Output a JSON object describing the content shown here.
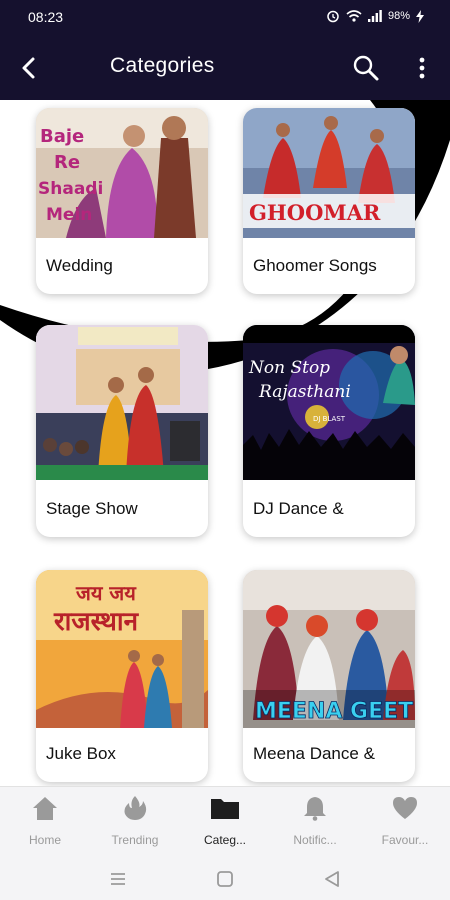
{
  "status_bar": {
    "time": "08:23",
    "battery": "98%"
  },
  "app_bar": {
    "title": "Categories"
  },
  "cards": [
    {
      "label": "Wedding",
      "poster_text": [
        "Baje",
        "Re",
        "Shaadi",
        "Mein"
      ]
    },
    {
      "label": "Ghoomer Songs",
      "poster_text": [
        "GHOOMAR"
      ]
    },
    {
      "label": "Stage Show",
      "poster_text": []
    },
    {
      "label": "DJ Dance &",
      "poster_text": [
        "Non Stop",
        "Rajasthani",
        "DJ BLAST"
      ]
    },
    {
      "label": "Juke Box",
      "poster_text": [
        "जय जय",
        "राजस्थान"
      ]
    },
    {
      "label": "Meena Dance &",
      "poster_text": [
        "MEENA GEET"
      ]
    }
  ],
  "bottom_nav": [
    {
      "label": "Home",
      "icon": "home-icon",
      "active": false
    },
    {
      "label": "Trending",
      "icon": "fire-icon",
      "active": false
    },
    {
      "label": "Categ...",
      "icon": "folder-icon",
      "active": true
    },
    {
      "label": "Notific...",
      "icon": "bell-icon",
      "active": false
    },
    {
      "label": "Favour...",
      "icon": "heart-icon",
      "active": false
    }
  ],
  "colors": {
    "app_bar": "#15112e",
    "nav_active": "#222222",
    "nav_inactive": "#9a9a9a"
  }
}
